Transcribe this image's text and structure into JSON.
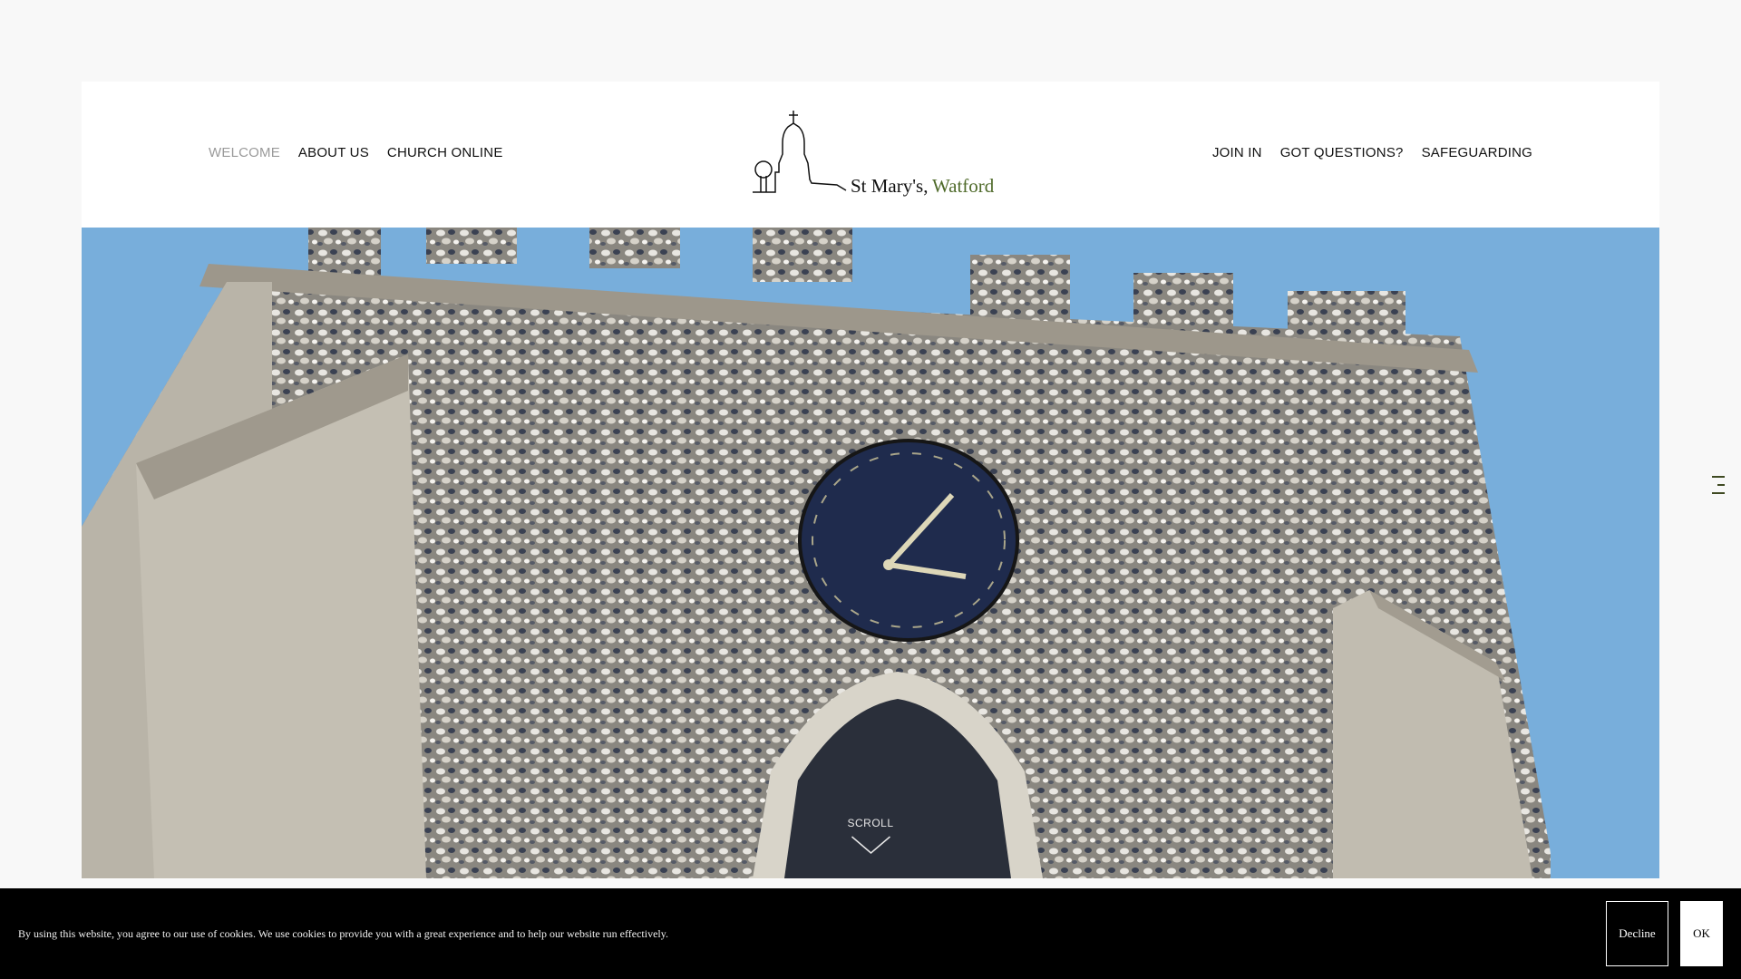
{
  "nav": {
    "left": [
      {
        "label": "WELCOME",
        "active": true
      },
      {
        "label": "ABOUT US",
        "active": false
      },
      {
        "label": "CHURCH ONLINE",
        "active": false
      }
    ],
    "right": [
      {
        "label": "JOIN IN"
      },
      {
        "label": "GOT QUESTIONS?"
      },
      {
        "label": "SAFEGUARDING"
      }
    ]
  },
  "logo": {
    "name": "St Mary's,",
    "place": "Watford",
    "accent_color": "#4f6a2a"
  },
  "hero": {
    "scroll_label": "SCROLL",
    "image_subject": "church tower with clock"
  },
  "cookie": {
    "text": "By using this website, you agree to our use of cookies. We use cookies to provide you with a great experience and to help our website run effectively.",
    "decline_label": "Decline",
    "ok_label": "OK"
  },
  "colors": {
    "sky": "#78aedb",
    "stone": "#bdb8ad",
    "active_nav": "#9a9a9a",
    "menu_icon": "#3f4a22"
  }
}
